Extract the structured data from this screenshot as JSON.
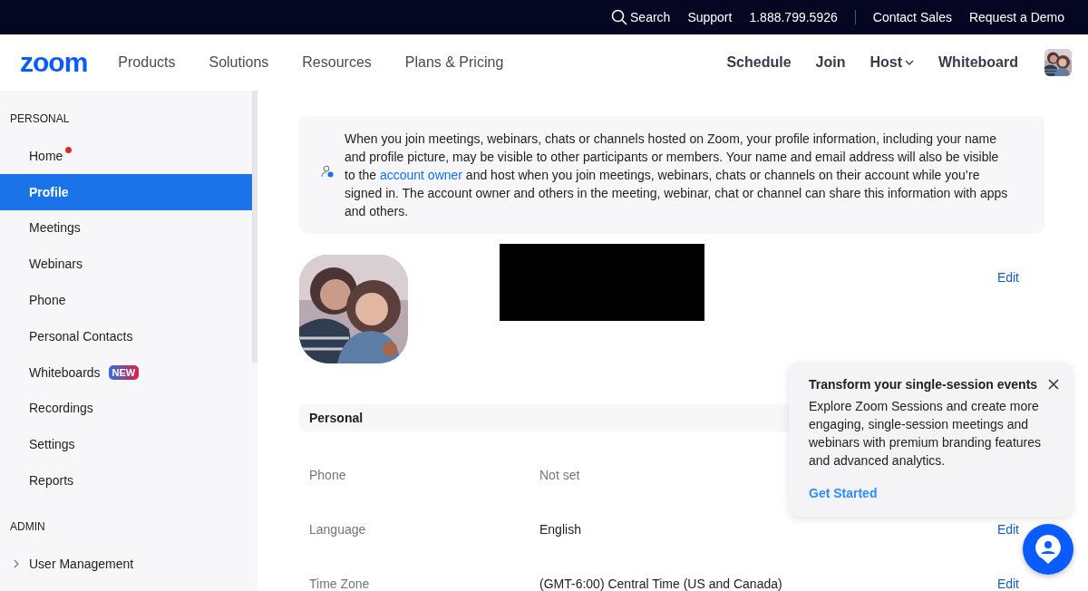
{
  "top_bar": {
    "links": [
      {
        "label": "Search",
        "kind": "search"
      },
      {
        "label": "Support",
        "kind": "link"
      },
      {
        "label": "1.888.799.5926",
        "kind": "phone"
      },
      {
        "label": "Contact Sales",
        "kind": "link"
      },
      {
        "label": "Request a Demo",
        "kind": "link"
      }
    ]
  },
  "nav": {
    "logo": "zoom",
    "left": [
      {
        "label": "Products"
      },
      {
        "label": "Solutions"
      },
      {
        "label": "Resources"
      },
      {
        "label": "Plans & Pricing"
      }
    ],
    "right": [
      {
        "label": "Schedule",
        "dropdown": false
      },
      {
        "label": "Join",
        "dropdown": false
      },
      {
        "label": "Host",
        "dropdown": true
      },
      {
        "label": "Whiteboard",
        "dropdown": false
      }
    ]
  },
  "sidebar": {
    "sections": [
      {
        "heading": "PERSONAL",
        "items": [
          {
            "label": "Home",
            "selected": false,
            "notification": true
          },
          {
            "label": "Profile",
            "selected": true,
            "notification": false
          },
          {
            "label": "Meetings",
            "selected": false,
            "notification": false
          },
          {
            "label": "Webinars",
            "selected": false,
            "notification": false
          },
          {
            "label": "Phone",
            "selected": false,
            "notification": false
          },
          {
            "label": "Personal Contacts",
            "selected": false,
            "notification": false
          },
          {
            "label": "Whiteboards",
            "selected": false,
            "notification": false,
            "badge": "NEW"
          },
          {
            "label": "Recordings",
            "selected": false,
            "notification": false
          },
          {
            "label": "Settings",
            "selected": false,
            "notification": false
          },
          {
            "label": "Reports",
            "selected": false,
            "notification": false
          }
        ]
      },
      {
        "heading": "ADMIN",
        "items": [
          {
            "label": "User Management",
            "selected": false,
            "notification": false,
            "expanded": false
          }
        ]
      }
    ]
  },
  "notice": {
    "before": "When you join meetings, webinars, chats or channels hosted on Zoom, your profile information, including your name and profile picture, may be visible to other participants or members. Your name and email address will also be visible to the ",
    "link": "account owner",
    "after": " and host when you join meetings, webinars, chats or channels on their account while you’re signed in. The account owner and others in the meeting, webinar, chat or channel can share this information with apps and others."
  },
  "profile": {
    "edit": "Edit"
  },
  "section": {
    "title": "Personal",
    "rows": [
      {
        "label": "Phone",
        "value": "Not set",
        "value_set": false
      },
      {
        "label": "Language",
        "value": "English",
        "value_set": true,
        "edit": "Edit"
      },
      {
        "label": "Time Zone",
        "value": "(GMT-6:00) Central Time (US and Canada)",
        "value_set": true,
        "edit": "Edit"
      }
    ]
  },
  "popup": {
    "title": "Transform your single-session events",
    "body": "Explore Zoom Sessions and create more engaging, single-session meetings and webinars with premium branding features and advanced analytics.",
    "action": "Get Started"
  }
}
